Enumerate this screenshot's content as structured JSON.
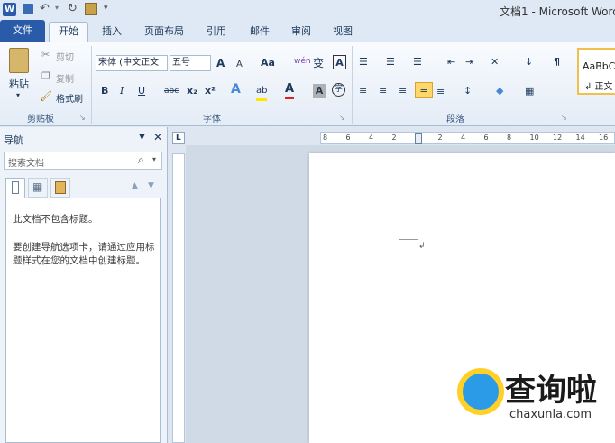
{
  "window": {
    "title": "文档1 - Microsoft Word"
  },
  "quick_access": {
    "icons": [
      "word-icon",
      "save-icon",
      "undo-icon",
      "redo-icon",
      "print-preview-icon",
      "customize-icon"
    ]
  },
  "tabs": {
    "file": "文件",
    "items": [
      "开始",
      "插入",
      "页面布局",
      "引用",
      "邮件",
      "审阅",
      "视图"
    ]
  },
  "clipboard": {
    "paste": "粘贴",
    "cut": "剪切",
    "copy": "复制",
    "format_painter": "格式刷",
    "group": "剪贴板"
  },
  "font": {
    "name": "宋体 (中文正文",
    "size": "五号",
    "group": "字体",
    "grow": "A",
    "shrink": "A",
    "case": "Aa",
    "wen": "wén",
    "bian": "变",
    "border_a": "A",
    "bold": "B",
    "italic": "I",
    "underline": "U",
    "strike": "abc",
    "sub": "x₂",
    "sup": "x²",
    "effects": "A",
    "highlight": "ab",
    "color": "A",
    "shading": "A",
    "enclose": "字"
  },
  "paragraph": {
    "group": "段落"
  },
  "styles": {
    "preview": "AaBbCc",
    "name": "↲ 正文"
  },
  "navigation": {
    "title": "导航",
    "search_placeholder": "搜索文档",
    "no_headings": "此文档不包含标题。",
    "hint": "要创建导航选项卡，请通过应用标题样式在您的文档中创建标题。"
  },
  "ruler": {
    "h_ticks": [
      "8",
      "6",
      "4",
      "2",
      "",
      "2",
      "4",
      "6",
      "8",
      "10",
      "12",
      "14",
      "16"
    ]
  },
  "watermark": {
    "text": "查询啦",
    "url": "chaxunla.com"
  }
}
